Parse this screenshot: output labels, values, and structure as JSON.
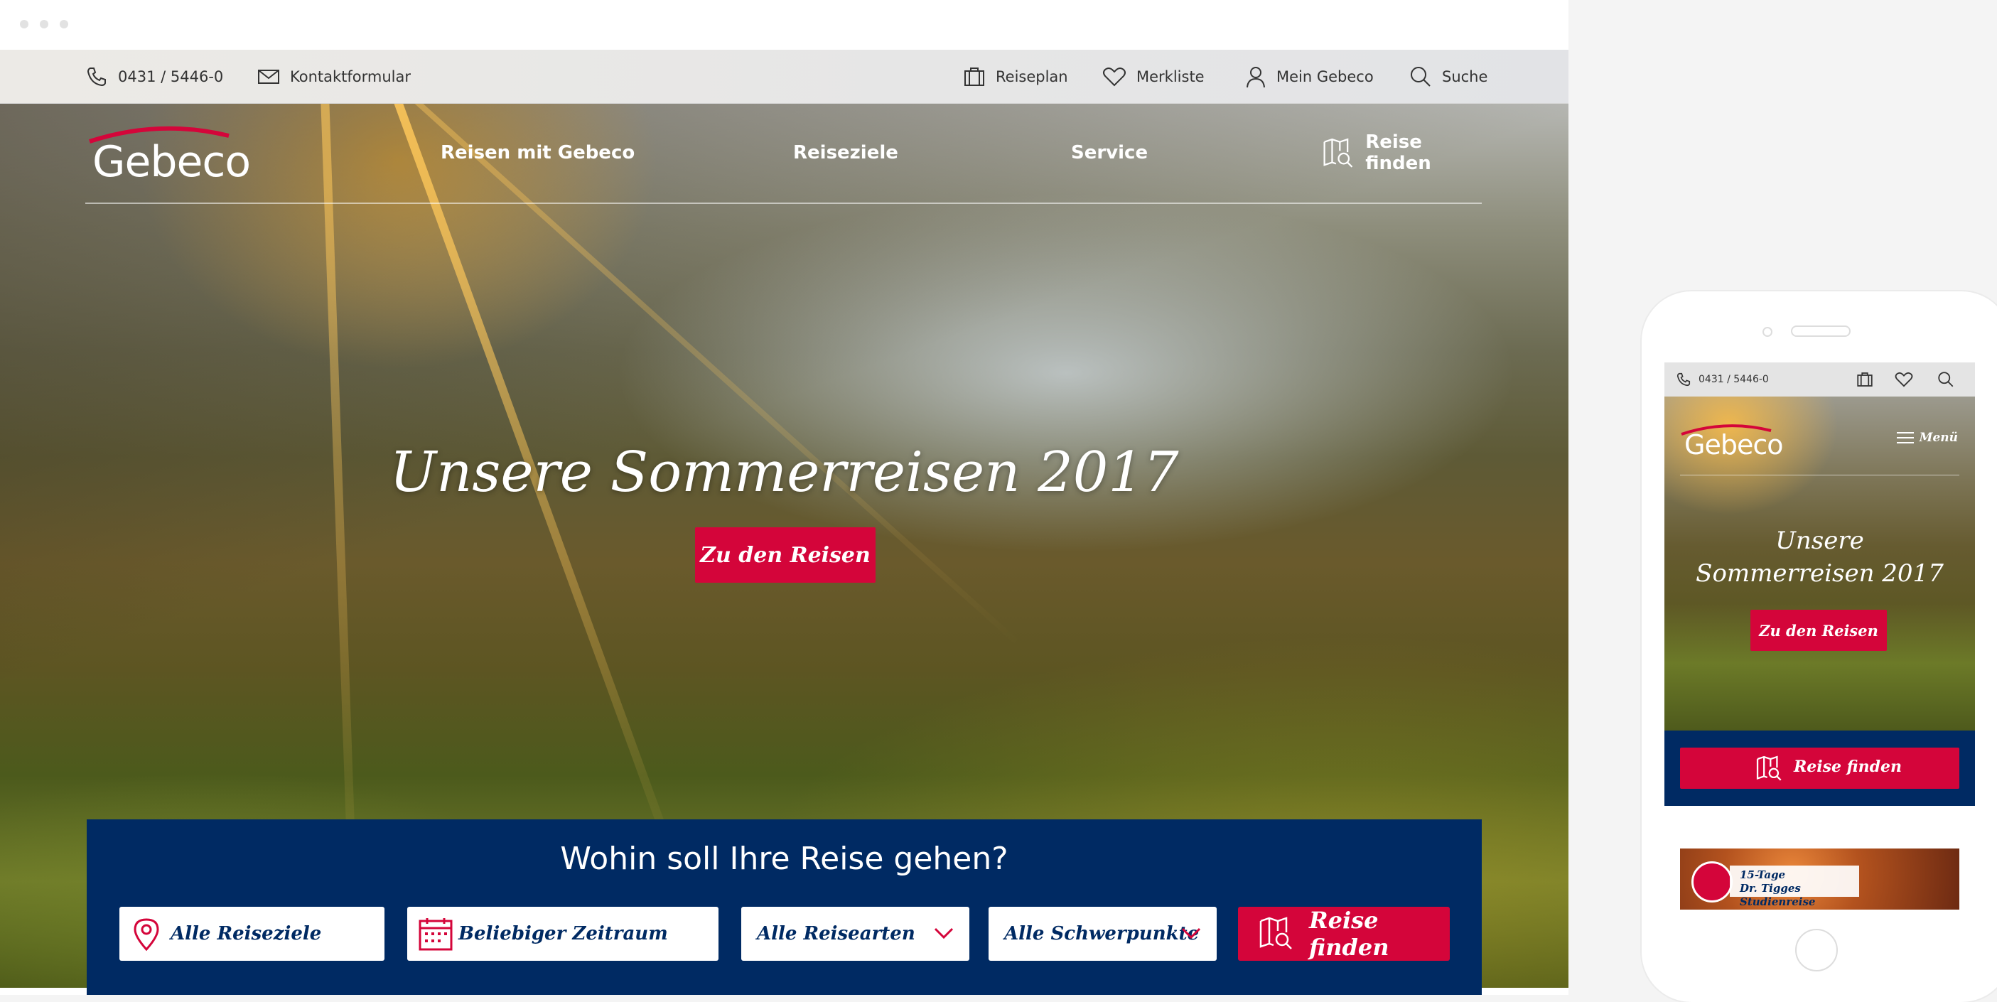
{
  "topbar": {
    "phone": "0431 / 5446-0",
    "contact": "Kontaktformular",
    "reiseplan": "Reiseplan",
    "merkliste": "Merkliste",
    "mein_gebeco": "Mein Gebeco",
    "suche": "Suche"
  },
  "nav": {
    "logo": "Gebeco",
    "items": [
      "Reisen mit Gebeco",
      "Reiseziele",
      "Service"
    ],
    "find": "Reise finden"
  },
  "hero": {
    "title": "Unsere Sommerreisen 2017",
    "button": "Zu den Reisen"
  },
  "search": {
    "title": "Wohin soll Ihre Reise gehen?",
    "destination": "Alle Reiseziele",
    "period": "Beliebiger Zeitraum",
    "types": "Alle Reisearten",
    "focus": "Alle Schwerpunkte",
    "button": "Reise finden"
  },
  "mobile": {
    "phone": "0431 / 5446-0",
    "logo": "Gebeco",
    "menu": "Menü",
    "title_line1": "Unsere",
    "title_line2": "Sommerreisen 2017",
    "button": "Zu den Reisen",
    "find": "Reise finden",
    "teaser_line1": "15-Tage",
    "teaser_line2": "Dr. Tigges Studienreise"
  },
  "colors": {
    "brand_red": "#d4053a",
    "brand_blue": "#002a63",
    "topbar_bg": "#e6e6e6"
  }
}
